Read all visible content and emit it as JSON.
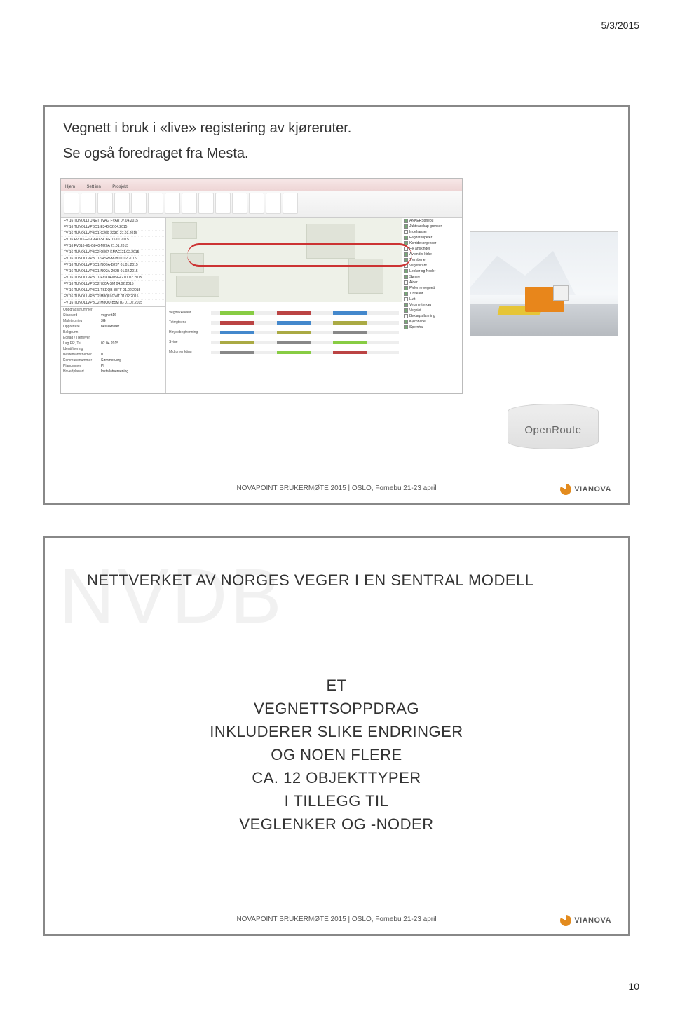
{
  "header": {
    "date": "5/3/2015"
  },
  "page_number": "10",
  "slide1": {
    "title": "Vegnett i bruk i «live» registering av kjøreruter.",
    "subtitle": "Se også foredraget fra Mesta.",
    "app": {
      "tree_items": [
        "FV 16 TUNOLLTUNET TVAG FVAR 07.04.2015",
        "FV 16 TUNOLLVPBO1-E340 02.04.2015",
        "FV 16 TUNOLLVPBO1-G260-223G 27.03.2015",
        "FV 16 FV016-E1-G840-SC6G 15.01.2015",
        "FV 16 FV016-E1-G840-M20A 21.01.2015",
        "FV 16 TUNOLLVPBO2-O867-KMAG 21.02.2015",
        "FV 16 TUNOLLVPBO1-94SW-M28 01.02.2015",
        "FV 16 TUNOLLVPBO1-NO9A-B237 01.01.2015",
        "FV 16 TUNOLLVPBO1-NO2A-202B 01.02.2015",
        "FV 16 TUNOLLVPBO1-E890A-M5E42 01.02.2015",
        "FV 16 TUNOLLVPBO2-780A-SM 04.02.2015",
        "FV 16 TUNOLLVPBO1-TSDQB-88FF 01.02.2015",
        "FV 16 TUNOLLVPBO2-M8QU-GWT 01.02.2015",
        "FV 16 TUNOLLVPBO2-M8QU-B5MTG 01.02.2015"
      ],
      "timeline_rows": [
        "Vegdekkekant",
        "Tetrrgtoene",
        "Høydebegtrenning",
        "Svine",
        "Midtomenkting"
      ],
      "right_panel_items": [
        "ANKERStmebu",
        "Jukteasskap grenser",
        "Ingehanser",
        "Fagdatenpkter",
        "Korridekorgenser",
        "Fik anskinger",
        "Avtender kirke",
        "Tjernbene",
        "Vegetskant",
        "Lenker og Noder",
        "Sømre",
        "Ålder",
        "Pielerne vegnett",
        "Trotikant",
        "Luft",
        "Vegmerterkag",
        "Vegniet",
        "Beklagsdlanning",
        "Kjernbane",
        "Spernhal"
      ]
    },
    "db_label": "OpenRoute",
    "footer": "NOVAPOINT BRUKERMØTE 2015  |  OSLO, Fornebu 21-23 april",
    "logo": "VIANOVA"
  },
  "slide2": {
    "bg_text": "NVDB",
    "title": "NETTVERKET AV NORGES VEGER I EN SENTRAL MODELL",
    "body_lines": [
      "ET",
      "VEGNETTSOPPDRAG",
      "INKLUDERER SLIKE ENDRINGER",
      "OG NOEN FLERE",
      "CA. 12 OBJEKTTYPER",
      "I TILLEGG TIL",
      "VEGLENKER OG -NODER"
    ],
    "footer": "NOVAPOINT BRUKERMØTE 2015  |  OSLO, Fornebu 21-23 april",
    "logo": "VIANOVA"
  }
}
